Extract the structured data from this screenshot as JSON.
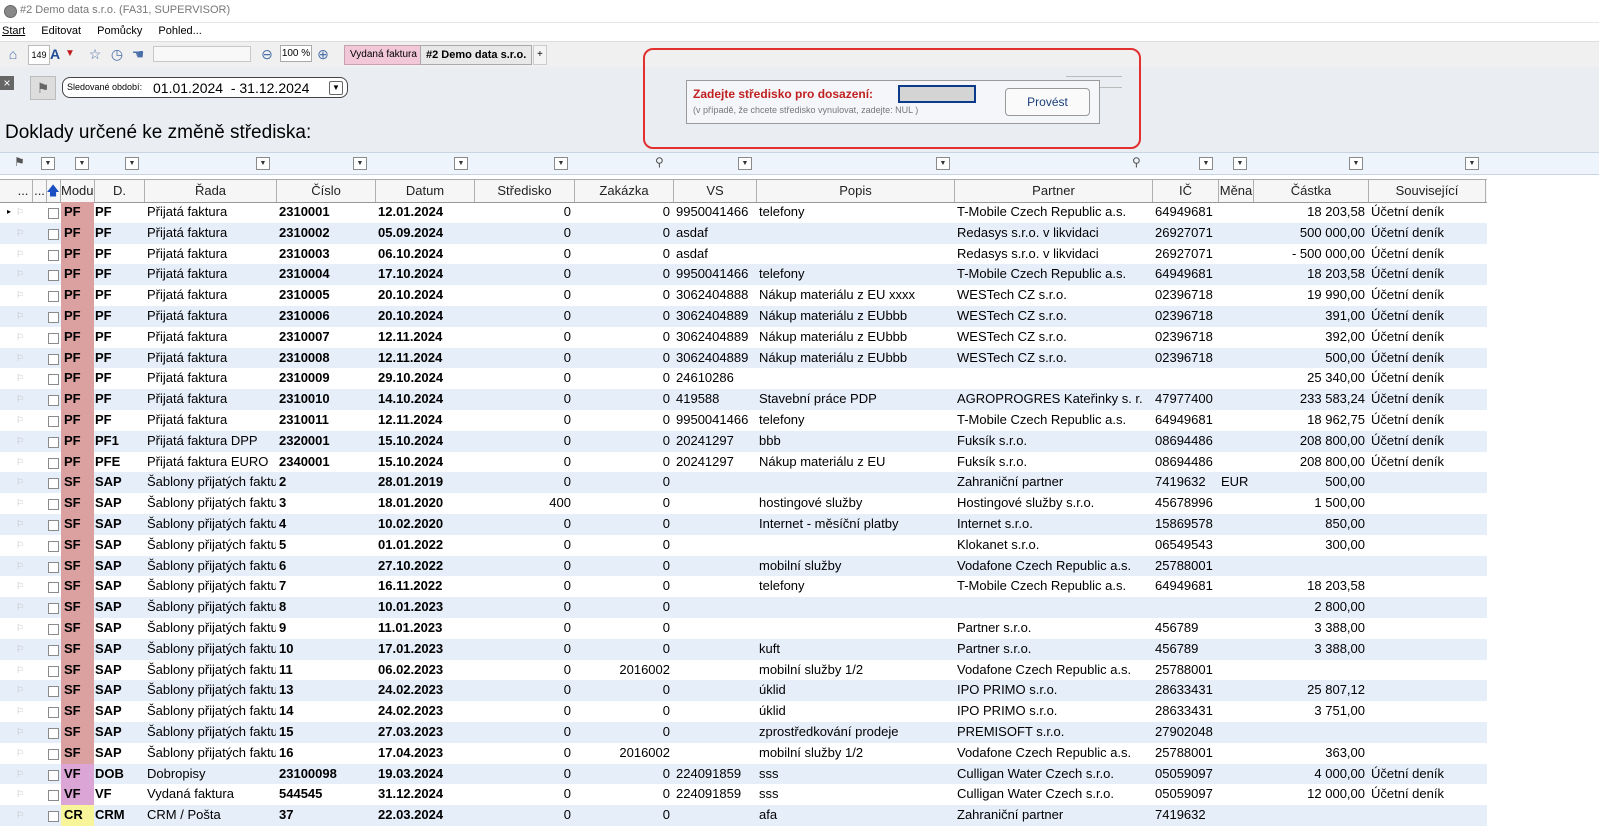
{
  "window": {
    "title": "#2 Demo data s.r.o. (FA31, SUPERVISOR)"
  },
  "menu": [
    "Start",
    "Editovat",
    "Pomůcky",
    "Pohled..."
  ],
  "toolbar": {
    "count_badge": "149",
    "zoom": "100 %",
    "tabs": [
      "Vydaná faktura",
      "#2 Demo data s.r.o.",
      "+"
    ]
  },
  "filter": {
    "period_label": "Sledované období:",
    "period_value": "01.01.2024  - 31.12.2024"
  },
  "heading": "Doklady určené ke změně střediska:",
  "dialog": {
    "title": "Zadejte středisko pro dosazení:",
    "input_value": "",
    "hint": "(v případě, že chcete středisko vynulovat, zadejte: NUL )",
    "button": "Provést"
  },
  "columns": {
    "dots": "...",
    "dots2": "...",
    "modul": "Modul",
    "d": "D.",
    "rada": "Řada",
    "cislo": "Číslo",
    "datum": "Datum",
    "stredisko": "Středisko",
    "zakazka": "Zakázka",
    "vs": "VS",
    "popis": "Popis",
    "partner": "Partner",
    "ic": "IČ",
    "mena": "Měna",
    "castka": "Částka",
    "souvisejici": "Související"
  },
  "rows": [
    {
      "mod": "PF",
      "d": "PF",
      "rada": "Přijatá faktura",
      "cislo": "2310001",
      "datum": "12.01.2024",
      "str": "0",
      "zak": "0",
      "vs": "9950041466",
      "popis": "telefony",
      "partner": "T-Mobile Czech Republic a.s.",
      "ic": "64949681",
      "mena": "",
      "castka": "18 203,58",
      "souv": "Účetní deník"
    },
    {
      "mod": "PF",
      "d": "PF",
      "rada": "Přijatá faktura",
      "cislo": "2310002",
      "datum": "05.09.2024",
      "str": "0",
      "zak": "0",
      "vs": "asdaf",
      "popis": "",
      "partner": "Redasys s.r.o. v likvidaci",
      "ic": "26927071",
      "mena": "",
      "castka": "500 000,00",
      "souv": "Účetní deník"
    },
    {
      "mod": "PF",
      "d": "PF",
      "rada": "Přijatá faktura",
      "cislo": "2310003",
      "datum": "06.10.2024",
      "str": "0",
      "zak": "0",
      "vs": "asdaf",
      "popis": "",
      "partner": "Redasys s.r.o. v likvidaci",
      "ic": "26927071",
      "mena": "",
      "castka": "- 500 000,00",
      "souv": "Účetní deník"
    },
    {
      "mod": "PF",
      "d": "PF",
      "rada": "Přijatá faktura",
      "cislo": "2310004",
      "datum": "17.10.2024",
      "str": "0",
      "zak": "0",
      "vs": "9950041466",
      "popis": "telefony",
      "partner": "T-Mobile Czech Republic a.s.",
      "ic": "64949681",
      "mena": "",
      "castka": "18 203,58",
      "souv": "Účetní deník"
    },
    {
      "mod": "PF",
      "d": "PF",
      "rada": "Přijatá faktura",
      "cislo": "2310005",
      "datum": "20.10.2024",
      "str": "0",
      "zak": "0",
      "vs": "3062404888",
      "popis": "Nákup materiálu z EU xxxx",
      "partner": "WESTech CZ s.r.o.",
      "ic": "02396718",
      "mena": "",
      "castka": "19 990,00",
      "souv": "Účetní deník"
    },
    {
      "mod": "PF",
      "d": "PF",
      "rada": "Přijatá faktura",
      "cislo": "2310006",
      "datum": "20.10.2024",
      "str": "0",
      "zak": "0",
      "vs": "3062404889",
      "popis": "Nákup materiálu z EUbbb",
      "partner": "WESTech CZ s.r.o.",
      "ic": "02396718",
      "mena": "",
      "castka": "391,00",
      "souv": "Účetní deník"
    },
    {
      "mod": "PF",
      "d": "PF",
      "rada": "Přijatá faktura",
      "cislo": "2310007",
      "datum": "12.11.2024",
      "str": "0",
      "zak": "0",
      "vs": "3062404889",
      "popis": "Nákup materiálu z EUbbb",
      "partner": "WESTech CZ s.r.o.",
      "ic": "02396718",
      "mena": "",
      "castka": "392,00",
      "souv": "Účetní deník"
    },
    {
      "mod": "PF",
      "d": "PF",
      "rada": "Přijatá faktura",
      "cislo": "2310008",
      "datum": "12.11.2024",
      "str": "0",
      "zak": "0",
      "vs": "3062404889",
      "popis": "Nákup materiálu z EUbbb",
      "partner": "WESTech CZ s.r.o.",
      "ic": "02396718",
      "mena": "",
      "castka": "500,00",
      "souv": "Účetní deník"
    },
    {
      "mod": "PF",
      "d": "PF",
      "rada": "Přijatá faktura",
      "cislo": "2310009",
      "datum": "29.10.2024",
      "str": "0",
      "zak": "0",
      "vs": "24610286",
      "popis": "",
      "partner": "",
      "ic": "",
      "mena": "",
      "castka": "25 340,00",
      "souv": "Účetní deník"
    },
    {
      "mod": "PF",
      "d": "PF",
      "rada": "Přijatá faktura",
      "cislo": "2310010",
      "datum": "14.10.2024",
      "str": "0",
      "zak": "0",
      "vs": "419588",
      "popis": "Stavební práce PDP",
      "partner": "AGROPROGRES Kateřinky s. r.",
      "ic": "47977400",
      "mena": "",
      "castka": "233 583,24",
      "souv": "Účetní deník"
    },
    {
      "mod": "PF",
      "d": "PF",
      "rada": "Přijatá faktura",
      "cislo": "2310011",
      "datum": "12.11.2024",
      "str": "0",
      "zak": "0",
      "vs": "9950041466",
      "popis": "telefony",
      "partner": "T-Mobile Czech Republic a.s.",
      "ic": "64949681",
      "mena": "",
      "castka": "18 962,75",
      "souv": "Účetní deník"
    },
    {
      "mod": "PF",
      "d": "PF1",
      "rada": "Přijatá faktura DPP",
      "cislo": "2320001",
      "datum": "15.10.2024",
      "str": "0",
      "zak": "0",
      "vs": "20241297",
      "popis": "bbb",
      "partner": "Fuksík s.r.o.",
      "ic": "08694486",
      "mena": "",
      "castka": "208 800,00",
      "souv": "Účetní deník"
    },
    {
      "mod": "PF",
      "d": "PFE",
      "rada": "Přijatá faktura EURO",
      "cislo": "2340001",
      "datum": "15.10.2024",
      "str": "0",
      "zak": "0",
      "vs": "20241297",
      "popis": "Nákup materiálu z EU",
      "partner": "Fuksík s.r.o.",
      "ic": "08694486",
      "mena": "",
      "castka": "208 800,00",
      "souv": "Účetní deník"
    },
    {
      "mod": "SF",
      "d": "SAP",
      "rada": "Šablony přijatých faktur",
      "cislo": "2",
      "datum": "28.01.2019",
      "str": "0",
      "zak": "0",
      "vs": "",
      "popis": "",
      "partner": "Zahraniční partner",
      "ic": "7419632",
      "mena": "EUR",
      "castka": "500,00",
      "souv": ""
    },
    {
      "mod": "SF",
      "d": "SAP",
      "rada": "Šablony přijatých faktur",
      "cislo": "3",
      "datum": "18.01.2020",
      "str": "400",
      "zak": "0",
      "vs": "",
      "popis": "hostingové služby",
      "partner": "Hostingové služby s.r.o.",
      "ic": "45678996",
      "mena": "",
      "castka": "1 500,00",
      "souv": ""
    },
    {
      "mod": "SF",
      "d": "SAP",
      "rada": "Šablony přijatých faktur",
      "cislo": "4",
      "datum": "10.02.2020",
      "str": "0",
      "zak": "0",
      "vs": "",
      "popis": "Internet - měsíční platby",
      "partner": "Internet s.r.o.",
      "ic": "15869578",
      "mena": "",
      "castka": "850,00",
      "souv": ""
    },
    {
      "mod": "SF",
      "d": "SAP",
      "rada": "Šablony přijatých faktur",
      "cislo": "5",
      "datum": "01.01.2022",
      "str": "0",
      "zak": "0",
      "vs": "",
      "popis": "",
      "partner": "Klokanet s.r.o.",
      "ic": "06549543",
      "mena": "",
      "castka": "300,00",
      "souv": ""
    },
    {
      "mod": "SF",
      "d": "SAP",
      "rada": "Šablony přijatých faktur",
      "cislo": "6",
      "datum": "27.10.2022",
      "str": "0",
      "zak": "0",
      "vs": "",
      "popis": "mobilní služby",
      "partner": "Vodafone Czech Republic a.s.",
      "ic": "25788001",
      "mena": "",
      "castka": "",
      "souv": ""
    },
    {
      "mod": "SF",
      "d": "SAP",
      "rada": "Šablony přijatých faktur",
      "cislo": "7",
      "datum": "16.11.2022",
      "str": "0",
      "zak": "0",
      "vs": "",
      "popis": "telefony",
      "partner": "T-Mobile Czech Republic a.s.",
      "ic": "64949681",
      "mena": "",
      "castka": "18 203,58",
      "souv": ""
    },
    {
      "mod": "SF",
      "d": "SAP",
      "rada": "Šablony přijatých faktur",
      "cislo": "8",
      "datum": "10.01.2023",
      "str": "0",
      "zak": "0",
      "vs": "",
      "popis": "",
      "partner": "",
      "ic": "",
      "mena": "",
      "castka": "2 800,00",
      "souv": ""
    },
    {
      "mod": "SF",
      "d": "SAP",
      "rada": "Šablony přijatých faktur",
      "cislo": "9",
      "datum": "11.01.2023",
      "str": "0",
      "zak": "0",
      "vs": "",
      "popis": "",
      "partner": "Partner s.r.o.",
      "ic": "456789",
      "mena": "",
      "castka": "3 388,00",
      "souv": ""
    },
    {
      "mod": "SF",
      "d": "SAP",
      "rada": "Šablony přijatých faktur",
      "cislo": "10",
      "datum": "17.01.2023",
      "str": "0",
      "zak": "0",
      "vs": "",
      "popis": "kuft",
      "partner": "Partner s.r.o.",
      "ic": "456789",
      "mena": "",
      "castka": "3 388,00",
      "souv": ""
    },
    {
      "mod": "SF",
      "d": "SAP",
      "rada": "Šablony přijatých faktur",
      "cislo": "11",
      "datum": "06.02.2023",
      "str": "0",
      "zak": "2016002",
      "vs": "",
      "popis": "mobilní služby 1/2",
      "partner": "Vodafone Czech Republic a.s.",
      "ic": "25788001",
      "mena": "",
      "castka": "",
      "souv": ""
    },
    {
      "mod": "SF",
      "d": "SAP",
      "rada": "Šablony přijatých faktur",
      "cislo": "13",
      "datum": "24.02.2023",
      "str": "0",
      "zak": "0",
      "vs": "",
      "popis": "úklid",
      "partner": "IPO PRIMO s.r.o.",
      "ic": "28633431",
      "mena": "",
      "castka": "25 807,12",
      "souv": ""
    },
    {
      "mod": "SF",
      "d": "SAP",
      "rada": "Šablony přijatých faktur",
      "cislo": "14",
      "datum": "24.02.2023",
      "str": "0",
      "zak": "0",
      "vs": "",
      "popis": "úklid",
      "partner": "IPO PRIMO s.r.o.",
      "ic": "28633431",
      "mena": "",
      "castka": "3 751,00",
      "souv": ""
    },
    {
      "mod": "SF",
      "d": "SAP",
      "rada": "Šablony přijatých faktur",
      "cislo": "15",
      "datum": "27.03.2023",
      "str": "0",
      "zak": "0",
      "vs": "",
      "popis": "zprostředkování prodeje",
      "partner": "PREMISOFT s.r.o.",
      "ic": "27902048",
      "mena": "",
      "castka": "",
      "souv": ""
    },
    {
      "mod": "SF",
      "d": "SAP",
      "rada": "Šablony přijatých faktur",
      "cislo": "16",
      "datum": "17.04.2023",
      "str": "0",
      "zak": "2016002",
      "vs": "",
      "popis": "mobilní služby 1/2",
      "partner": "Vodafone Czech Republic a.s.",
      "ic": "25788001",
      "mena": "",
      "castka": "363,00",
      "souv": ""
    },
    {
      "mod": "VF",
      "d": "DOB",
      "rada": "Dobropisy",
      "cislo": "23100098",
      "datum": "19.03.2024",
      "str": "0",
      "zak": "0",
      "vs": "224091859",
      "popis": "sss",
      "partner": "Culligan Water Czech s.r.o.",
      "ic": "05059097",
      "mena": "",
      "castka": "4 000,00",
      "souv": "Účetní deník"
    },
    {
      "mod": "VF",
      "d": "VF",
      "rada": "Vydaná faktura",
      "cislo": "544545",
      "datum": "31.12.2024",
      "str": "0",
      "zak": "0",
      "vs": "224091859",
      "popis": "sss",
      "partner": "Culligan Water Czech s.r.o.",
      "ic": "05059097",
      "mena": "",
      "castka": "12 000,00",
      "souv": "Účetní deník"
    },
    {
      "mod": "CR",
      "d": "CRM",
      "rada": "CRM / Pošta",
      "cislo": "37",
      "datum": "22.03.2024",
      "str": "0",
      "zak": "0",
      "vs": "",
      "popis": "afa",
      "partner": "Zahraniční partner",
      "ic": "7419632",
      "mena": "",
      "castka": "",
      "souv": ""
    }
  ]
}
